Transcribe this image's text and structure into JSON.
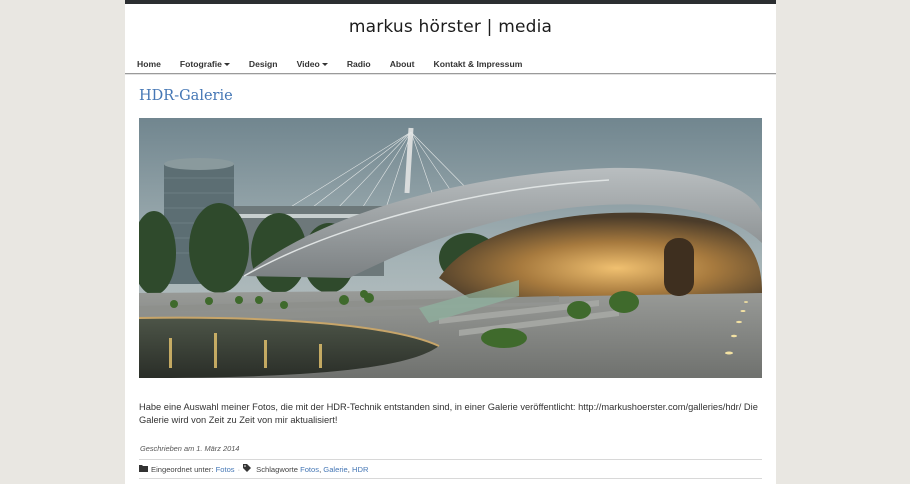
{
  "site": {
    "title": "markus hörster | media"
  },
  "nav": [
    {
      "label": "Home",
      "dropdown": false
    },
    {
      "label": "Fotografie",
      "dropdown": true
    },
    {
      "label": "Design",
      "dropdown": false
    },
    {
      "label": "Video",
      "dropdown": true
    },
    {
      "label": "Radio",
      "dropdown": false
    },
    {
      "label": "About",
      "dropdown": false
    },
    {
      "label": "Kontakt & Impressum",
      "dropdown": false
    }
  ],
  "post": {
    "title": "HDR-Galerie",
    "body": "Habe eine Auswahl meiner Fotos, die mit der HDR-Technik entstanden sind, in einer Galerie veröffentlicht: http://markushoerster.com/galleries/hdr/ Die Galerie wird von Zeit zu Zeit von mir aktualisiert!",
    "date_line": "Geschrieben am 1. März 2014",
    "category_label": "Eingeordnet unter:",
    "category": "Fotos",
    "separator": "·",
    "tags_label": "Schlagworte",
    "tags": [
      "Fotos",
      "Galerie",
      "HDR"
    ]
  },
  "icons": {
    "category": "folder-icon",
    "tags": "tags-icon",
    "dropdown": "caret-down-icon"
  },
  "colors": {
    "link": "#4577b5",
    "topbar": "#2b2e31",
    "background": "#e9e7e2"
  }
}
